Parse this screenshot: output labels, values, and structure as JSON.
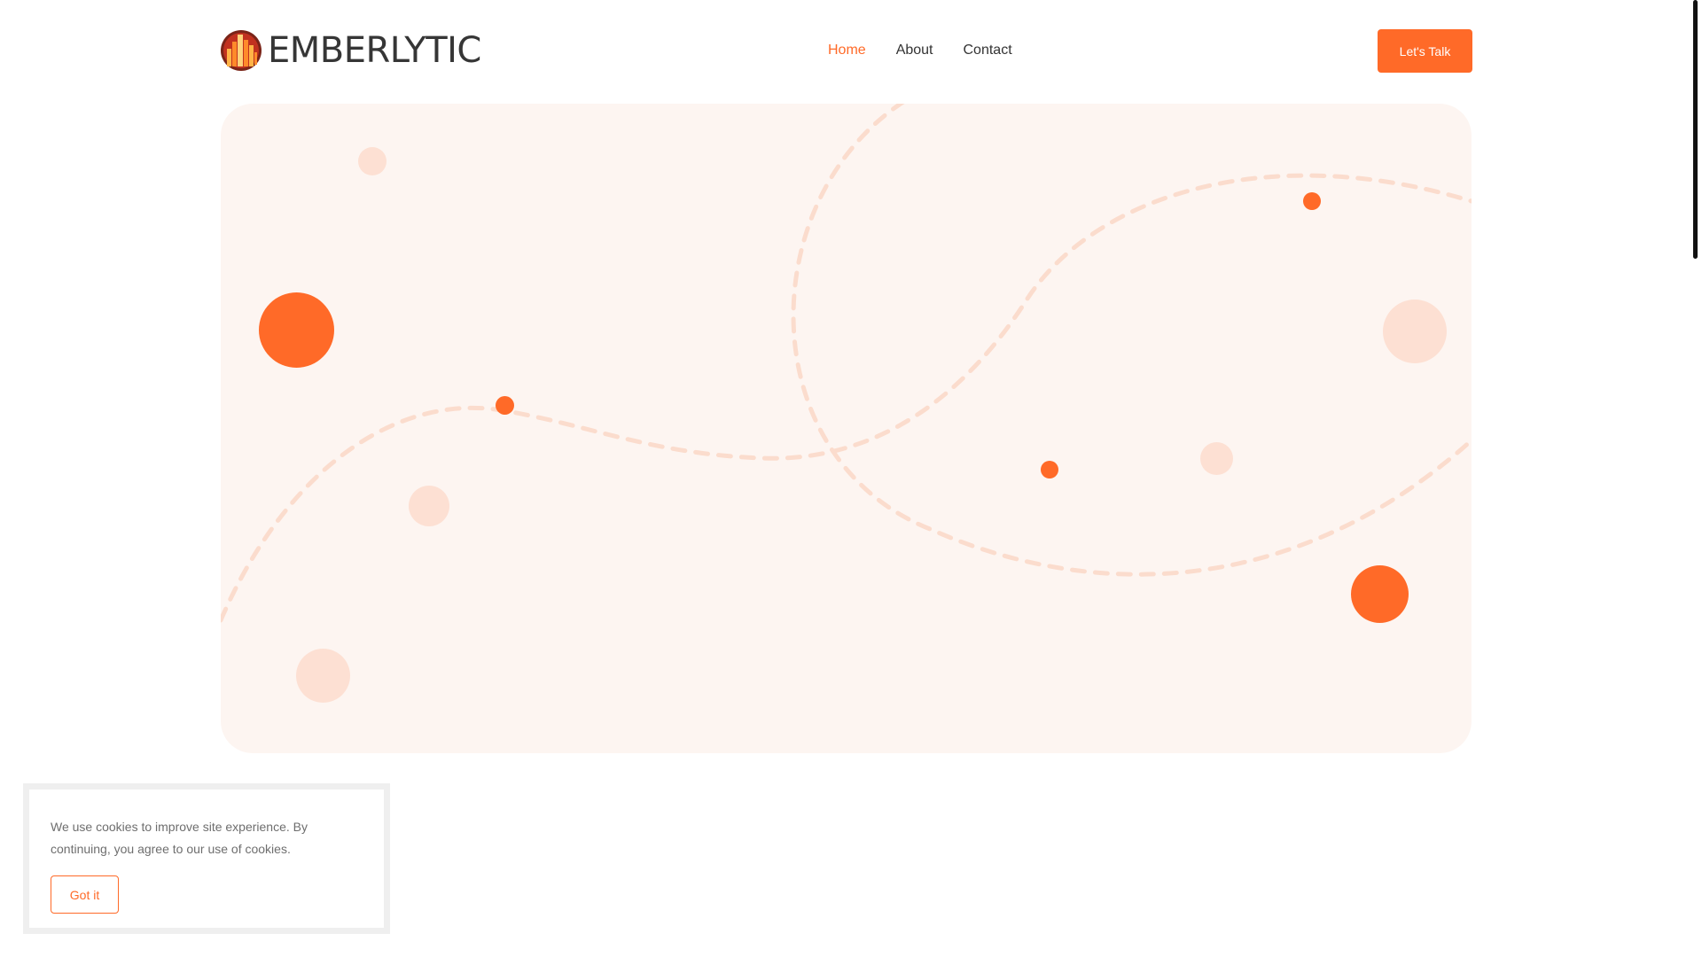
{
  "brand": {
    "name": "EMBERLYTIC",
    "logo_icon": "city-skyline-logo-icon",
    "colors": {
      "accent": "#ff6a28",
      "text_dark": "#333333",
      "hero_background": "#fdf5f1",
      "soft_dot": "#fde0d3"
    }
  },
  "nav": {
    "items": [
      {
        "label": "Home",
        "active": true
      },
      {
        "label": "About",
        "active": false
      },
      {
        "label": "Contact",
        "active": false
      }
    ]
  },
  "header": {
    "cta_label": "Let's Talk"
  },
  "cookie_banner": {
    "message": "We use cookies to improve site experience. By continuing, you agree to our use of cookies.",
    "button_label": "Got it"
  }
}
